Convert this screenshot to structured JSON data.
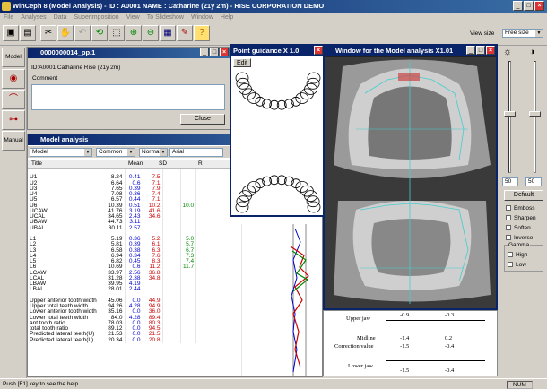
{
  "app": {
    "title": "WinCeph 8 (Model Analysis) - ID : A0001  NAME : Catharine (21y 2m) - RISE CORPORATION DEMO"
  },
  "menu": [
    "File",
    "Analyses",
    "Data",
    "Superimposition",
    "View",
    "To Slideshow",
    "Window",
    "Help"
  ],
  "toolbar": {
    "view_size_label": "View size",
    "view_size_value": "Free size"
  },
  "sidebar": {
    "tabs": [
      "Model",
      "",
      "",
      "",
      "Manual"
    ]
  },
  "patient_window": {
    "title": "0000000014_pp.1",
    "patient_line": "ID:A0001 Catharine Rise (21y 2m)",
    "comment_label": "Comment",
    "close_label": "Close"
  },
  "analysis_window": {
    "title": "Model analysis",
    "selects": {
      "analysis": "Model",
      "standard": "Common",
      "normal": "Normal",
      "font": "Arial"
    },
    "headers": {
      "title": "Title",
      "mean": "Mean",
      "sd": "SD",
      "r": "R"
    },
    "rows": [
      [
        "",
        "",
        "",
        "",
        "",
        ""
      ],
      [
        "U1",
        "8.24",
        "0.41",
        "7.5",
        "",
        ""
      ],
      [
        "U2",
        "6.64",
        "0.6",
        "7.1",
        "",
        ""
      ],
      [
        "U3",
        "7.65",
        "0.39",
        "7.9",
        "",
        ""
      ],
      [
        "U4",
        "7.08",
        "0.36",
        "7.4",
        "",
        ""
      ],
      [
        "U5",
        "6.57",
        "0.44",
        "7.1",
        "",
        ""
      ],
      [
        "U6",
        "10.39",
        "0.51",
        "10.2",
        "",
        "10.0"
      ],
      [
        "UCAW",
        "41.76",
        "3.19",
        "41.6",
        "",
        ""
      ],
      [
        "UCAL",
        "34.65",
        "2.43",
        "34.6",
        "",
        ""
      ],
      [
        "UBAW",
        "44.73",
        "3.11",
        "",
        ""
      ],
      [
        "UBAL",
        "30.11",
        "2.57",
        "",
        ""
      ],
      [
        "",
        "",
        "",
        "",
        "",
        ""
      ],
      [
        "L1",
        "5.19",
        "0.36",
        "5.2",
        "",
        "5.0"
      ],
      [
        "L2",
        "5.81",
        "0.39",
        "6.1",
        "",
        "5.7"
      ],
      [
        "L3",
        "6.58",
        "0.38",
        "6.3",
        "",
        "6.7"
      ],
      [
        "L4",
        "6.94",
        "0.34",
        "7.6",
        "",
        "7.3"
      ],
      [
        "L5",
        "6.82",
        "0.45",
        "8.3",
        "",
        "7.4"
      ],
      [
        "L6",
        "10.69",
        "0.6",
        "11.2",
        "",
        "11.7"
      ],
      [
        "LCAW",
        "33.97",
        "2.56",
        "36.8",
        "",
        ""
      ],
      [
        "LCAL",
        "31.28",
        "2.38",
        "34.8",
        "",
        ""
      ],
      [
        "LBAW",
        "39.95",
        "4.19",
        "",
        ""
      ],
      [
        "LBAL",
        "28.01",
        "2.44",
        "",
        ""
      ],
      [
        "",
        "",
        "",
        "",
        "",
        ""
      ],
      [
        "Upper anterior tooth width",
        "45.06",
        "0.0",
        "44.9",
        "",
        ""
      ],
      [
        "Upper total teeth width",
        "94.26",
        "4.28",
        "94.9",
        "",
        ""
      ],
      [
        "Lower anterior tooth width",
        "35.16",
        "0.0",
        "36.0",
        "",
        ""
      ],
      [
        "Lower total teeth width",
        "84.0",
        "4.28",
        "89.4",
        "",
        ""
      ],
      [
        "ant tooth ratio",
        "78.03",
        "0.0",
        "80.3",
        "",
        ""
      ],
      [
        "total tooth ratio",
        "89.12",
        "0.0",
        "94.5",
        "",
        ""
      ],
      [
        "Predicted lateral teeth(U)",
        "21.53",
        "0.0",
        "21.5",
        "",
        ""
      ],
      [
        "Predicted lateral teeth(L)",
        "20.34",
        "0.0",
        "20.8",
        "",
        ""
      ]
    ]
  },
  "guidance_window": {
    "title": "Point guidance X 1.0",
    "edit_label": "Edit"
  },
  "model_window": {
    "title": "Window for the Model analysis X1.01"
  },
  "measurements": {
    "upper_jaw": "Upper jaw",
    "midline": "Midline",
    "correction_value": "Correction value",
    "lower_jaw": "Lower jaw",
    "values": {
      "upper_left": "-0.9",
      "upper_right": "-0.3",
      "mid_left": "-1.4",
      "mid_right": "0.2",
      "corr_left": "-1.5",
      "corr_right": "-0.4",
      "lower_left": "-1.5",
      "lower_right": "-0.4"
    }
  },
  "image_panel": {
    "field1": "50",
    "field2": "50",
    "default_label": "Default",
    "options": [
      "Emboss",
      "Sharpen",
      "Soften",
      "Inverse"
    ],
    "gamma_label": "Gamma",
    "gamma_options": [
      "High",
      "Low"
    ]
  },
  "statusbar": {
    "hint": "Push [F1] key to see the help.",
    "num": "NUM"
  }
}
